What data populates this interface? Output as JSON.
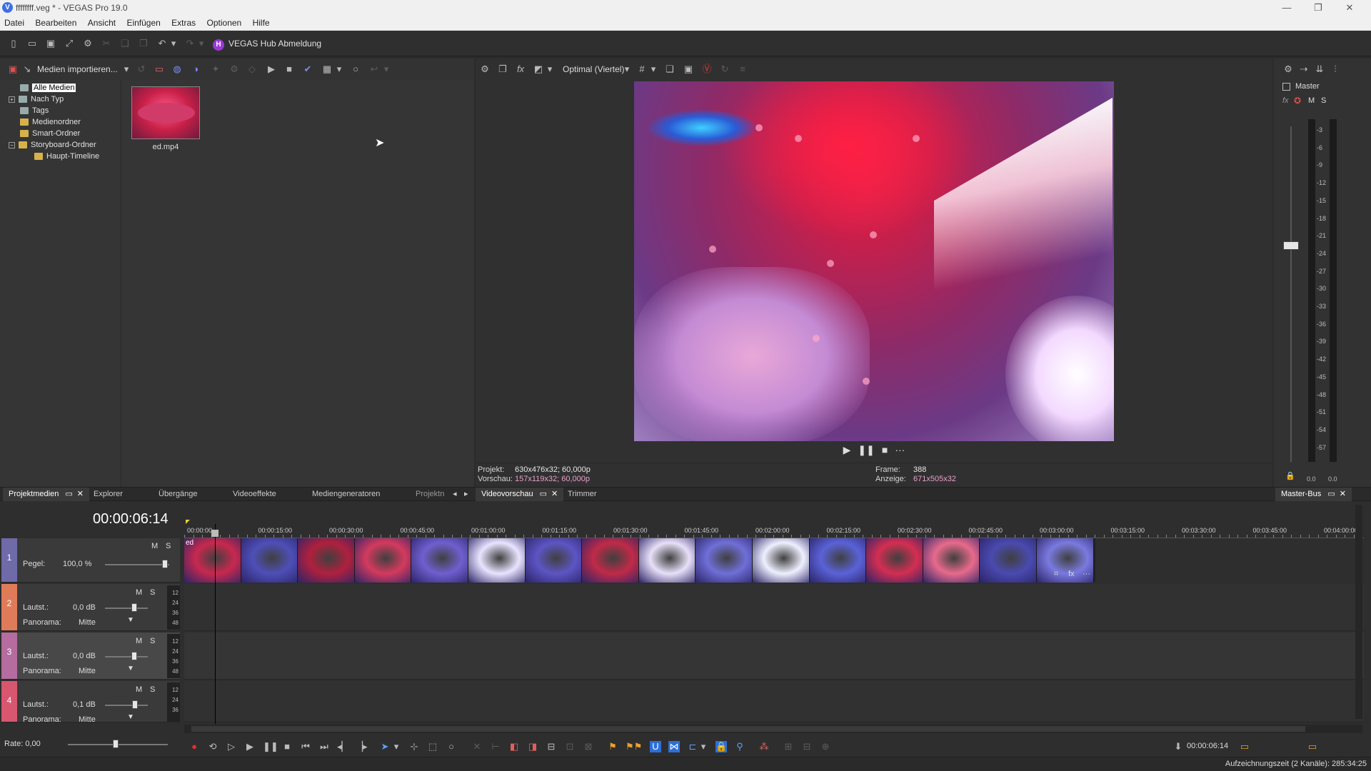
{
  "window": {
    "title": "ffffffff.veg * - VEGAS Pro 19.0",
    "logo": "V"
  },
  "menu": [
    "Datei",
    "Bearbeiten",
    "Ansicht",
    "Einfügen",
    "Extras",
    "Optionen",
    "Hilfe"
  ],
  "toolbar": {
    "hub_icon": "H",
    "hub_label": "VEGAS Hub Abmeldung"
  },
  "media": {
    "import_label": "Medien importieren...",
    "tree": [
      "Alle Medien",
      "Nach Typ",
      "Tags",
      "Medienordner",
      "Smart-Ordner",
      "Storyboard-Ordner",
      "Haupt-Timeline"
    ],
    "file_name": "ed.mp4"
  },
  "preview": {
    "quality_label": "Optimal (Viertel)",
    "projekt_label": "Projekt:",
    "projekt_value": "630x476x32; 60,000p",
    "vorschau_label": "Vorschau:",
    "vorschau_value": "157x119x32; 60,000p",
    "frame_label": "Frame:",
    "frame_value": "388",
    "anzeige_label": "Anzeige:",
    "anzeige_value": "671x505x32"
  },
  "master": {
    "label": "Master",
    "fx": "fx",
    "m": "M",
    "s": "S",
    "scale": [
      "3",
      "6",
      "9",
      "12",
      "15",
      "18",
      "21",
      "24",
      "27",
      "30",
      "33",
      "36",
      "39",
      "42",
      "45",
      "48",
      "51",
      "54",
      "57"
    ],
    "left_value": "0.0",
    "right_value": "0.0"
  },
  "tabs": {
    "projektmedien": "Projektmedien",
    "explorer": "Explorer",
    "uebergaenge": "Übergänge",
    "videoeffekte": "Videoeffekte",
    "mediengeneratoren": "Mediengeneratoren",
    "projekt": "Projektn",
    "videovorschau": "Videovorschau",
    "trimmer": "Trimmer",
    "masterbus": "Master-Bus"
  },
  "timeline": {
    "timecode": "00:00:06:14",
    "ruler": [
      "00:00:00",
      "00:00:15:00",
      "00:00:30:00",
      "00:00:45:00",
      "00:01:00:00",
      "00:01:15:00",
      "00:01:30:00",
      "00:01:45:00",
      "00:02:00:00",
      "00:02:15:00",
      "00:02:30:00",
      "00:02:45:00",
      "00:03:00:00",
      "00:03:15:00",
      "00:03:30:00",
      "00:03:45:00",
      "00:04:00:00"
    ],
    "clip_label": "ed",
    "tracks": [
      {
        "num": "1",
        "label": "Pegel:",
        "value": "100,0 %"
      },
      {
        "num": "2",
        "label": "Lautst.:",
        "value": "0,0 dB",
        "pan_label": "Panorama:",
        "pan_value": "Mitte"
      },
      {
        "num": "3",
        "label": "Lautst.:",
        "value": "0,0 dB",
        "pan_label": "Panorama:",
        "pan_value": "Mitte"
      },
      {
        "num": "4",
        "label": "Lautst.:",
        "value": "0,1 dB",
        "pan_label": "Panorama:",
        "pan_value": "Mitte"
      }
    ],
    "db_scale": [
      "12",
      "24",
      "36",
      "48"
    ],
    "m": "M",
    "s": "S",
    "rate": "Rate: 0,00",
    "cursor_time": "00:00:06:14"
  },
  "status": "Aufzeichnungszeit (2 Kanäle): 285:34:25"
}
